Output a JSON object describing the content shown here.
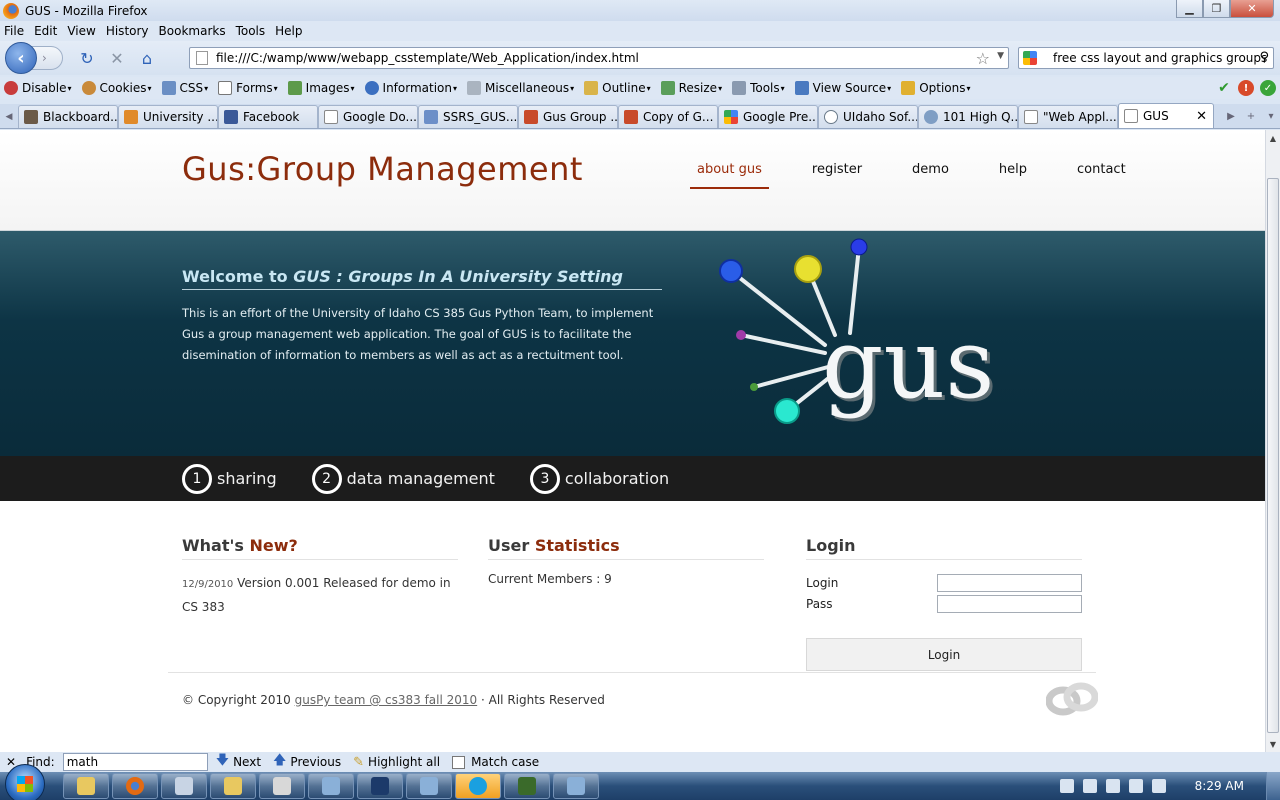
{
  "window": {
    "title": "GUS - Mozilla Firefox",
    "minimize": "▁",
    "maximize": "❐",
    "close": "✕"
  },
  "menubar": {
    "items": [
      "File",
      "Edit",
      "View",
      "History",
      "Bookmarks",
      "Tools",
      "Help"
    ]
  },
  "navbar": {
    "url": "file:///C:/wamp/www/webapp_csstemplate/Web_Application/index.html",
    "search_value": "free css layout and graphics groups"
  },
  "devbar": {
    "items": [
      "Disable",
      "Cookies",
      "CSS",
      "Forms",
      "Images",
      "Information",
      "Miscellaneous",
      "Outline",
      "Resize",
      "Tools",
      "View Source",
      "Options"
    ]
  },
  "tabs": [
    {
      "label": "Blackboard..."
    },
    {
      "label": "University ..."
    },
    {
      "label": "Facebook"
    },
    {
      "label": "Google Do..."
    },
    {
      "label": "SSRS_GUS..."
    },
    {
      "label": "Gus Group ..."
    },
    {
      "label": "Copy of G..."
    },
    {
      "label": "Google Pre..."
    },
    {
      "label": "UIdaho Sof..."
    },
    {
      "label": "101 High Q..."
    },
    {
      "label": "\"Web Appl..."
    },
    {
      "label": "GUS"
    }
  ],
  "site": {
    "logo": "Gus:Group Management",
    "nav": [
      "about gus",
      "register",
      "demo",
      "help",
      "contact"
    ],
    "hero": {
      "title_prefix": "Welcome to ",
      "title_em": "GUS : Groups In A University Setting",
      "body": "This is an effort of the University of Idaho CS 385 Gus Python Team, to implement Gus a group management web application. The goal of GUS is to facilitate the disemination of information to members as well as act as a rectuitment tool.",
      "art_text": "gus"
    },
    "features": [
      {
        "num": "1",
        "label": "sharing"
      },
      {
        "num": "2",
        "label": "data management"
      },
      {
        "num": "3",
        "label": "collaboration"
      }
    ],
    "whats_new": {
      "title_a": "What's ",
      "title_b": "New?",
      "date": "12/9/2010",
      "text": " Version 0.001 Released for demo in CS 383"
    },
    "stats": {
      "title_a": "User ",
      "title_b": "Statistics",
      "members": "Current Members : 9"
    },
    "login": {
      "title": "Login",
      "login_label": "Login",
      "pass_label": "Pass",
      "button": "Login"
    },
    "footer": {
      "prefix": "© Copyright 2010 ",
      "link": "gusPy team @ cs383 fall 2010",
      "suffix": " · All Rights Reserved"
    }
  },
  "findbar": {
    "close": "✕",
    "label": "Find:",
    "value": "math",
    "next": "Next",
    "previous": "Previous",
    "highlight": "Highlight all",
    "match_case": "Match case"
  },
  "taskbar": {
    "clock": "8:29 AM"
  }
}
